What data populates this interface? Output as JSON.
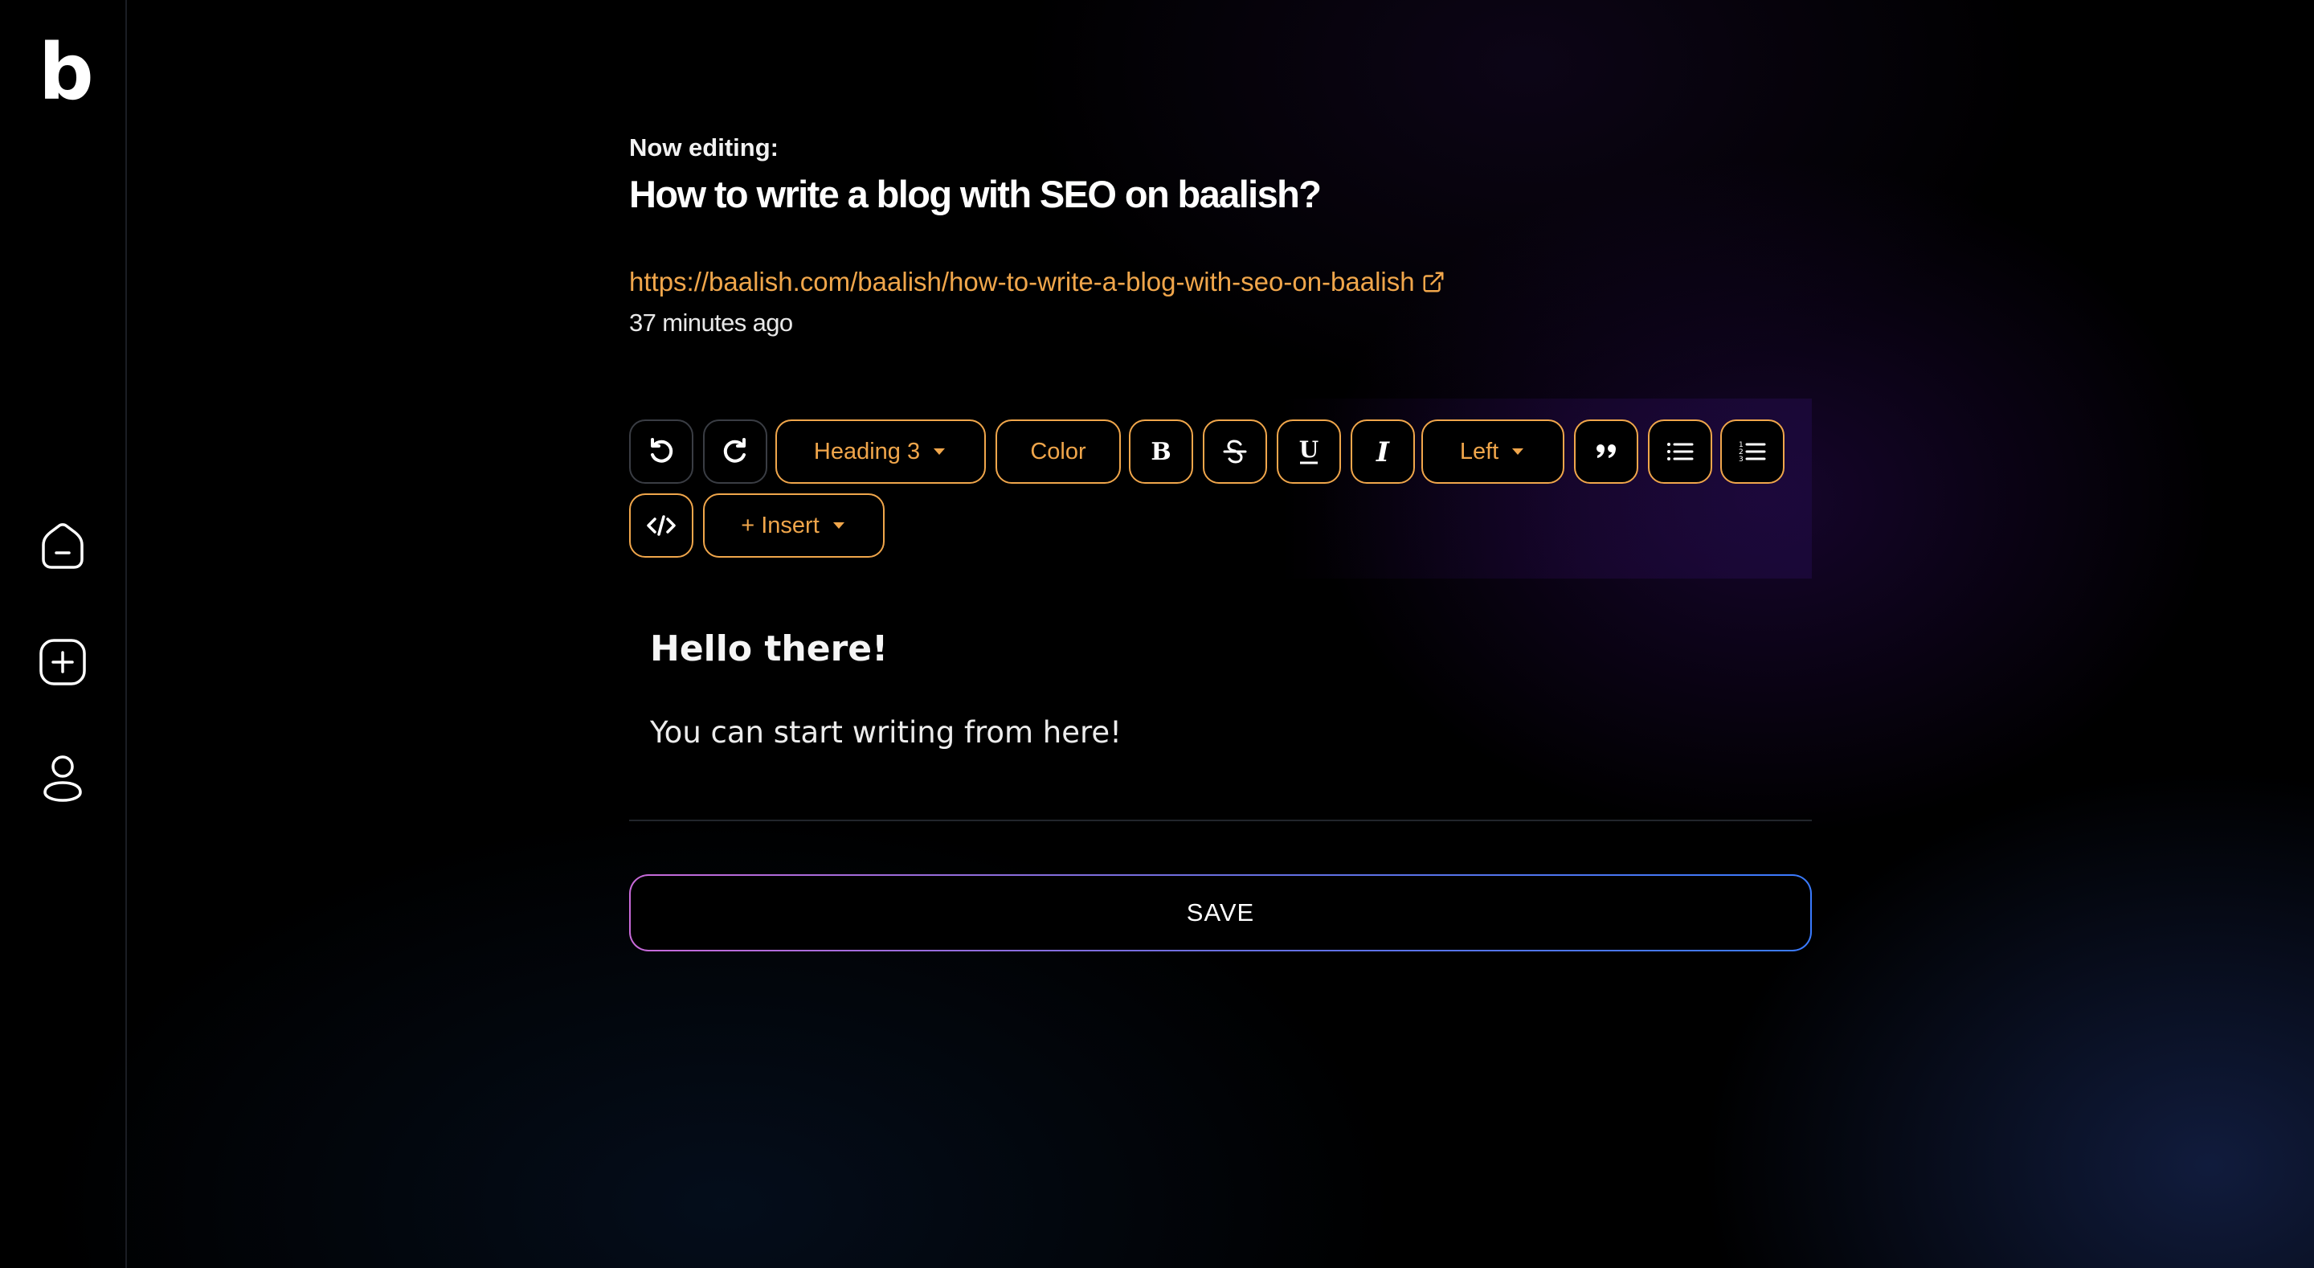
{
  "sidebar": {
    "logo": "b",
    "items": [
      {
        "name": "home",
        "icon": "home-icon"
      },
      {
        "name": "new-post",
        "icon": "plus-square-icon"
      },
      {
        "name": "profile",
        "icon": "user-icon"
      }
    ]
  },
  "header": {
    "now_editing_label": "Now editing:",
    "title": "How to write a blog with SEO on baalish?",
    "url": "https://baalish.com/baalish/how-to-write-a-blog-with-seo-on-baalish",
    "timestamp": "37 minutes ago"
  },
  "toolbar": {
    "undo_icon": "undo-icon",
    "redo_icon": "redo-icon",
    "heading_select": "Heading 3",
    "color_label": "Color",
    "bold_icon": "bold-icon",
    "strike_icon": "strikethrough-icon",
    "underline_icon": "underline-icon",
    "italic_icon": "italic-icon",
    "align_select": "Left",
    "quote_icon": "quote-icon",
    "bullet_list_icon": "bullet-list-icon",
    "ordered_list_icon": "ordered-list-icon",
    "code_icon": "code-icon",
    "insert_label": "+ Insert"
  },
  "editor": {
    "heading": "Hello there!",
    "paragraph": "You can start writing from here!"
  },
  "save_label": "SAVE",
  "colors": {
    "accent": "#f0a64b",
    "background": "#000000",
    "save_gradient_start": "#c86ad9",
    "save_gradient_end": "#3a7bff"
  }
}
